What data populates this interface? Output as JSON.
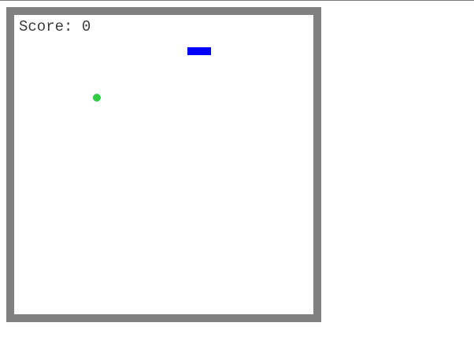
{
  "score": {
    "label": "Score:",
    "value": "0"
  },
  "colors": {
    "border": "#808080",
    "board": "#ffffff",
    "snake": "#0000ff",
    "food": "#2ecc40",
    "text": "#3c3c3c"
  }
}
